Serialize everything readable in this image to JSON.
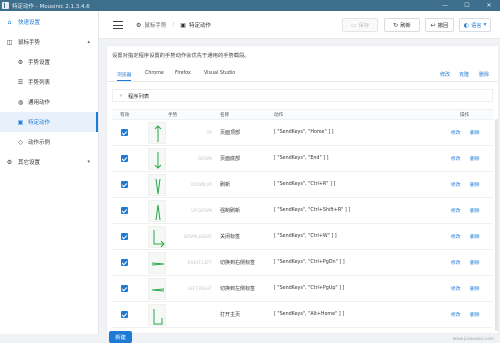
{
  "window": {
    "title": "特定动作 - Mousinic 2.1.3.4.6",
    "min": "—",
    "max": "☐",
    "close": "✕"
  },
  "sidebar": {
    "items": [
      {
        "icon": "home-icon",
        "glyph": "⌂",
        "label": "快速设置",
        "chevron": ""
      },
      {
        "icon": "mouse-icon",
        "glyph": "◫",
        "label": "鼠标手势",
        "chevron": "▴"
      },
      {
        "icon": "settings-icon",
        "glyph": "⚙",
        "label": "手势设置",
        "chevron": ""
      },
      {
        "icon": "list-icon",
        "glyph": "☰",
        "label": "手势列表",
        "chevron": ""
      },
      {
        "icon": "general-action-icon",
        "glyph": "◍",
        "label": "通用动作",
        "chevron": ""
      },
      {
        "icon": "special-action-icon",
        "glyph": "▣",
        "label": "特定动作",
        "chevron": ""
      },
      {
        "icon": "example-icon",
        "glyph": "◇",
        "label": "动作示例",
        "chevron": ""
      },
      {
        "icon": "other-settings-icon",
        "glyph": "⚙",
        "label": "其它设置",
        "chevron": "▾"
      }
    ]
  },
  "header": {
    "breadcrumb": [
      {
        "icon": "gear-icon",
        "glyph": "⚙",
        "label": "鼠标手势"
      },
      {
        "icon": "action-icon",
        "glyph": "▣",
        "label": "特定动作"
      }
    ],
    "separator": "/",
    "buttons": {
      "save": {
        "glyph": "▭",
        "label": "保存"
      },
      "refresh": {
        "glyph": "↻",
        "label": "刷新"
      },
      "back": {
        "glyph": "↩",
        "label": "撤回"
      },
      "lang": {
        "glyph": "◐",
        "label": "语言",
        "caret": "▾"
      }
    }
  },
  "content": {
    "description": "设置对指定程序设置的手势动作会优先于通用的手势截段。",
    "tabs": [
      "浏览器",
      "Chrome",
      "Firefox",
      "Visual Studio"
    ],
    "tab_actions": [
      "修改",
      "克隆",
      "删除"
    ],
    "program": {
      "chevron": "›",
      "label": "程序列表"
    },
    "columns": {
      "enabled": "有效",
      "gesture": "手势",
      "name": "名称",
      "action": "动作",
      "ops": "操作"
    },
    "rows": [
      {
        "gesture": "UP",
        "name": "页面顶部",
        "action": "[ \"SendKeys\", \"Home\" ] ]",
        "edit": "修改",
        "delete": "删除"
      },
      {
        "gesture": "DOWN",
        "name": "页面底部",
        "action": "[ \"SendKeys\", \"End\" ] ]",
        "edit": "修改",
        "delete": "删除"
      },
      {
        "gesture": "DOWN,UP",
        "name": "刷新",
        "action": "[ \"SendKeys\", \"Ctrl+R\" ] ]",
        "edit": "修改",
        "delete": "删除"
      },
      {
        "gesture": "UP,DOWN",
        "name": "强制刷新",
        "action": "[ \"SendKeys\", \"Ctrl+Shift+R\" ] ]",
        "edit": "修改",
        "delete": "删除"
      },
      {
        "gesture": "DOWN,RIGHT",
        "name": "关闭标签",
        "action": "[ \"SendKeys\", \"Ctrl+W\" ] ]",
        "edit": "修改",
        "delete": "删除"
      },
      {
        "gesture": "RIGHT,LEFT",
        "name": "切换到右侧标签",
        "action": "[ \"SendKeys\", \"Ctrl+PgDn\" ] ]",
        "edit": "修改",
        "delete": "删除"
      },
      {
        "gesture": "LEFT,RIGHT",
        "name": "切换到左侧标签",
        "action": "[ \"SendKeys\", \"Ctrl+PgUp\" ] ]",
        "edit": "修改",
        "delete": "删除"
      },
      {
        "gesture": "",
        "name": "打开主页",
        "action": "[ \"SendKeys\", \"Alt+Home\" ] ]",
        "edit": "修改",
        "delete": "删除"
      }
    ],
    "new_button": "新建"
  },
  "watermark": "www.jixiaoaoxi.com",
  "colors": {
    "accent": "#1e7ad7",
    "titlebar": "#3d6f8c",
    "gesture_line": "#2aa84a"
  }
}
